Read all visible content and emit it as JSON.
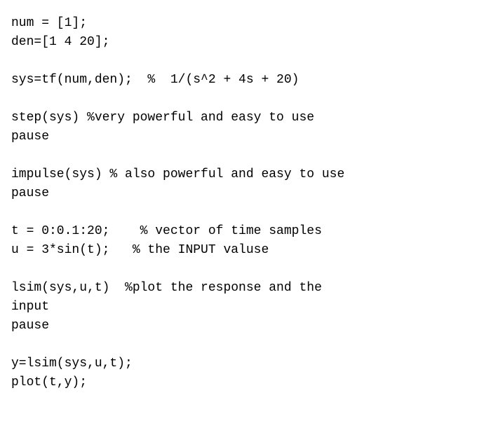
{
  "code": {
    "lines": [
      "num = [1];",
      "den=[1 4 20];",
      "",
      "sys=tf(num,den);  %  1/(s^2 + 4s + 20)",
      "",
      "step(sys) %very powerful and easy to use",
      "pause",
      "",
      "impulse(sys) % also powerful and easy to use",
      "pause",
      "",
      "t = 0:0.1:20;    % vector of time samples",
      "u = 3*sin(t);   % the INPUT valuse",
      "",
      "lsim(sys,u,t)  %plot the response and the",
      "input",
      "pause",
      "",
      "y=lsim(sys,u,t);",
      "plot(t,y);"
    ]
  }
}
